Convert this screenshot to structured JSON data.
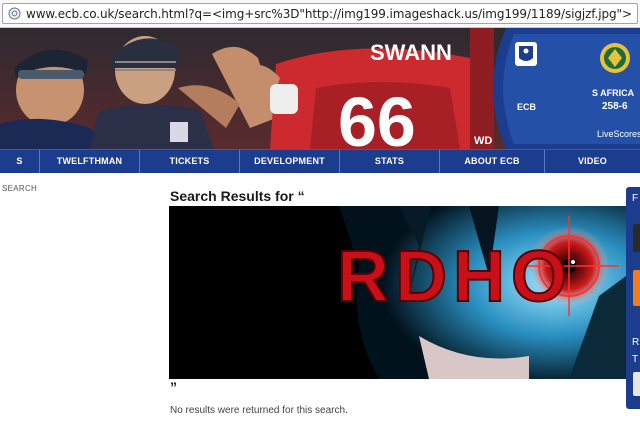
{
  "browser": {
    "url": "www.ecb.co.uk/search.html?q=<img+src%3D\"http://img199.imageshack.us/img199/1189/sigjzf.jpg\">"
  },
  "banner": {
    "ecb_label": "ECB",
    "opponent": "S AFRICA",
    "opponent_score": "258-6",
    "livescores_label": "LiveScores"
  },
  "nav": {
    "items": [
      {
        "label": "S"
      },
      {
        "label": "TWELFTHMAN"
      },
      {
        "label": "TICKETS"
      },
      {
        "label": "DEVELOPMENT"
      },
      {
        "label": "STATS"
      },
      {
        "label": "ABOUT ECB"
      },
      {
        "label": "VIDEO"
      }
    ]
  },
  "breadcrumb": "SEARCH",
  "search": {
    "results_title": "Search Results for “",
    "close_quote": "”",
    "no_results": "No results were returned for this search.",
    "injected_image_text": "RDHO"
  },
  "side_widget": {
    "letter_top": "F",
    "letter_r": "R",
    "letter_t": "T"
  },
  "colors": {
    "nav_blue": "#1c3c8e",
    "banner_red": "#c8262c"
  }
}
